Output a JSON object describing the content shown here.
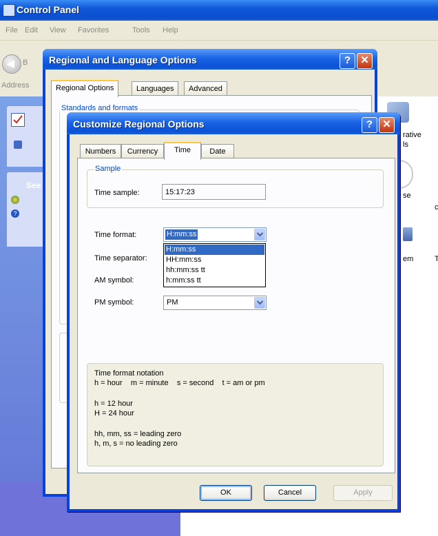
{
  "control_panel": {
    "title": "Control Panel",
    "menu": [
      "File",
      "Edit",
      "View",
      "Favorites",
      "Tools",
      "Help"
    ],
    "back_label": "B",
    "address_label": "Address",
    "taskpane_header": "See",
    "right_fragments": [
      "rative",
      "ls",
      "se",
      "c",
      "em",
      "T"
    ]
  },
  "regional_dialog": {
    "title": "Regional and Language Options",
    "help_label": "?",
    "close_label": "✕",
    "tabs": [
      "Regional Options",
      "Languages",
      "Advanced"
    ],
    "standards_legend": "Standards and formats"
  },
  "customize_dialog": {
    "title": "Customize Regional Options",
    "help_label": "?",
    "close_label": "✕",
    "tabs": [
      "Numbers",
      "Currency",
      "Time",
      "Date"
    ],
    "active_tab": "Time",
    "sample_legend": "Sample",
    "time_sample_label": "Time sample:",
    "time_sample_value": "15:17:23",
    "time_format_label": "Time format:",
    "time_format_value": "H:mm:ss",
    "time_format_options": [
      "H:mm:ss",
      "HH:mm:ss",
      "hh:mm:ss tt",
      "h:mm:ss tt"
    ],
    "time_separator_label": "Time separator:",
    "am_symbol_label": "AM symbol:",
    "pm_symbol_label": "PM symbol:",
    "pm_symbol_value": "PM",
    "notation": {
      "title": "Time format notation",
      "line1": "h = hour    m = minute    s = second    t = am or pm",
      "line2": "h = 12 hour",
      "line3": "H = 24 hour",
      "line4": "hh, mm, ss = leading zero",
      "line5": "h, m, s = no leading zero"
    },
    "buttons": {
      "ok": "OK",
      "cancel": "Cancel",
      "apply": "Apply"
    }
  },
  "colors": {
    "titlebar_blue": "#0a4fcf",
    "dialog_face": "#ece9d8",
    "selection": "#316ac5",
    "group_legend": "#0046d5",
    "close_red": "#c1350f"
  }
}
